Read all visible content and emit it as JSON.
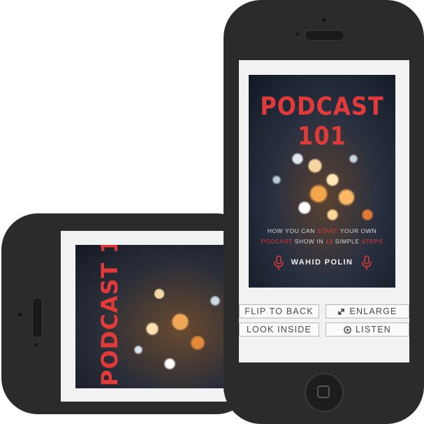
{
  "book": {
    "title": "PODCAST 101",
    "subtitle": {
      "line1_a": "HOW YOU CAN ",
      "line1_hl": "START",
      "line1_b": " YOUR OWN",
      "line2_hl1": "PODCAST",
      "line2_a": " SHOW IN ",
      "line2_hl2": "10",
      "line2_b": " SIMPLE ",
      "line2_hl3": "STEPS"
    },
    "author": "WAHID POLIN"
  },
  "buttons": {
    "flip_to_back": "FLIP TO BACK",
    "enlarge": "ENLARGE",
    "look_inside": "LOOK INSIDE",
    "listen": "LISTEN"
  },
  "icons": {
    "enlarge": "arrows-expand-icon",
    "listen": "play-circle-icon",
    "microphone": "microphone-icon"
  },
  "colors": {
    "accent": "#e23a3a",
    "device": "#2b2b2b"
  }
}
